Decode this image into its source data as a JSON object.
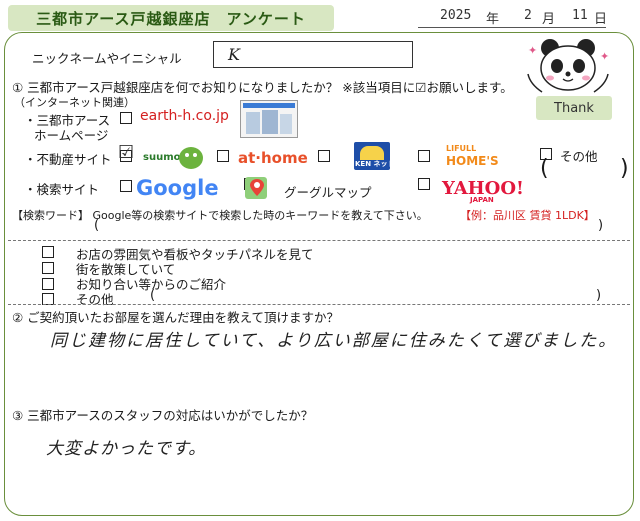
{
  "header": {
    "title": "三都市アース戸越銀座店　アンケート",
    "date": {
      "year": "2025",
      "year_unit": "年",
      "month": "2",
      "month_unit": "月",
      "day": "11",
      "day_unit": "日"
    }
  },
  "nickname": {
    "label": "ニックネームやイニシャル",
    "value": "K"
  },
  "thank_label": "Thank",
  "q1": {
    "text": "① 三都市アース戸越銀座店を何でお知りになりましたか？ ※該当項目に☑お願いします。",
    "internet_label": "（インターネット関連）",
    "homepage_label_1": "・三都市アース",
    "homepage_label_2": "ホームページ",
    "homepage_url": "earth-h.co.jp",
    "realestate_label": "・不動産サイト",
    "realestate_check": "☑",
    "suumo": "suumo",
    "athome": "at·home",
    "kensaku": "KEN ネット",
    "lifull_1": "LIFULL",
    "lifull_2": "HOME'S",
    "other_label": "その他",
    "paren_open": "(",
    "paren_close": ")",
    "search_label": "・検索サイト",
    "google": "Google",
    "googlemap": "グーグルマップ",
    "yahoo": "YAHOO!",
    "yahoo_sub": "JAPAN",
    "keyword_label": "【検索ワード】 Google等の検索サイトで検索した時のキーワードを教えて下さい。",
    "keyword_example": "【例：品川区 賃貸 1LDK】",
    "offline_items": [
      "お店の雰囲気や看板やタッチパネルを見て",
      "街を散策していて",
      "お知り合い等からのご紹介",
      "その他"
    ]
  },
  "q2": {
    "text": "② ご契約頂いたお部屋を選んだ理由を教えて頂けますか？",
    "answer": "同じ建物に居住していて、より広い部屋に住みたくて選びました。"
  },
  "q3": {
    "text": "③ 三都市アースのスタッフの対応はいかがでしたか？",
    "answer": "大変よかったです。"
  },
  "colors": {
    "accent": "#2a5a14",
    "title_bg": "#d8e7c2",
    "frame": "#6a8f3c",
    "example_red": "#d42020"
  }
}
